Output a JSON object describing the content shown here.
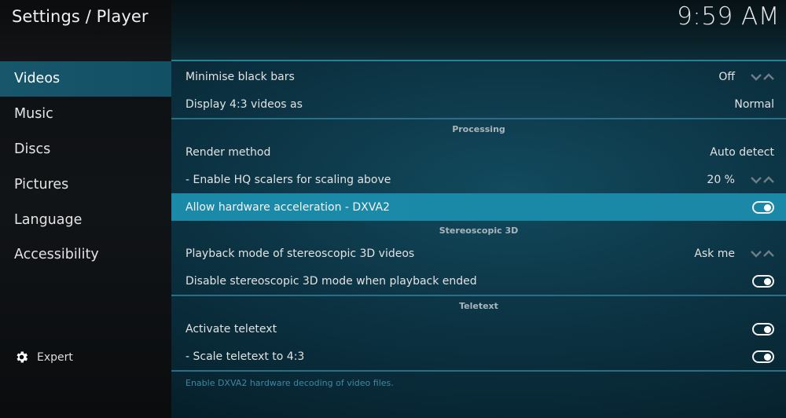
{
  "header": {
    "title": "Settings / Player",
    "clock": "9:59 AM"
  },
  "sidebar": {
    "items": [
      {
        "label": "Videos",
        "active": true
      },
      {
        "label": "Music",
        "active": false
      },
      {
        "label": "Discs",
        "active": false
      },
      {
        "label": "Pictures",
        "active": false
      },
      {
        "label": "Language",
        "active": false
      },
      {
        "label": "Accessibility",
        "active": false
      }
    ],
    "level": {
      "label": "Expert",
      "icon": "gear-icon"
    }
  },
  "settings": {
    "general": [
      {
        "label": "Minimise black bars",
        "value": "Off",
        "control": "spinner"
      },
      {
        "label": "Display 4:3 videos as",
        "value": "Normal",
        "control": "list"
      }
    ],
    "processing": {
      "title": "Processing",
      "items": [
        {
          "label": "Render method",
          "value": "Auto detect",
          "control": "list"
        },
        {
          "label": "- Enable HQ scalers for scaling above",
          "value": "20 %",
          "control": "spinner"
        },
        {
          "label": "Allow hardware acceleration - DXVA2",
          "value": "on",
          "control": "toggle",
          "focused": true
        }
      ]
    },
    "stereoscopic": {
      "title": "Stereoscopic 3D",
      "items": [
        {
          "label": "Playback mode of stereoscopic 3D videos",
          "value": "Ask me",
          "control": "spinner"
        },
        {
          "label": "Disable stereoscopic 3D mode when playback ended",
          "value": "on",
          "control": "toggle"
        }
      ]
    },
    "teletext": {
      "title": "Teletext",
      "items": [
        {
          "label": "Activate teletext",
          "value": "on",
          "control": "toggle"
        },
        {
          "label": "- Scale teletext to 4:3",
          "value": "on",
          "control": "toggle"
        }
      ]
    }
  },
  "hint": "Enable DXVA2 hardware decoding of video files.",
  "colors": {
    "accent": "#1b8aa9",
    "sidebar_active": "#17566b",
    "separator": "#2b6f86",
    "hint_text": "#3d89a3"
  }
}
